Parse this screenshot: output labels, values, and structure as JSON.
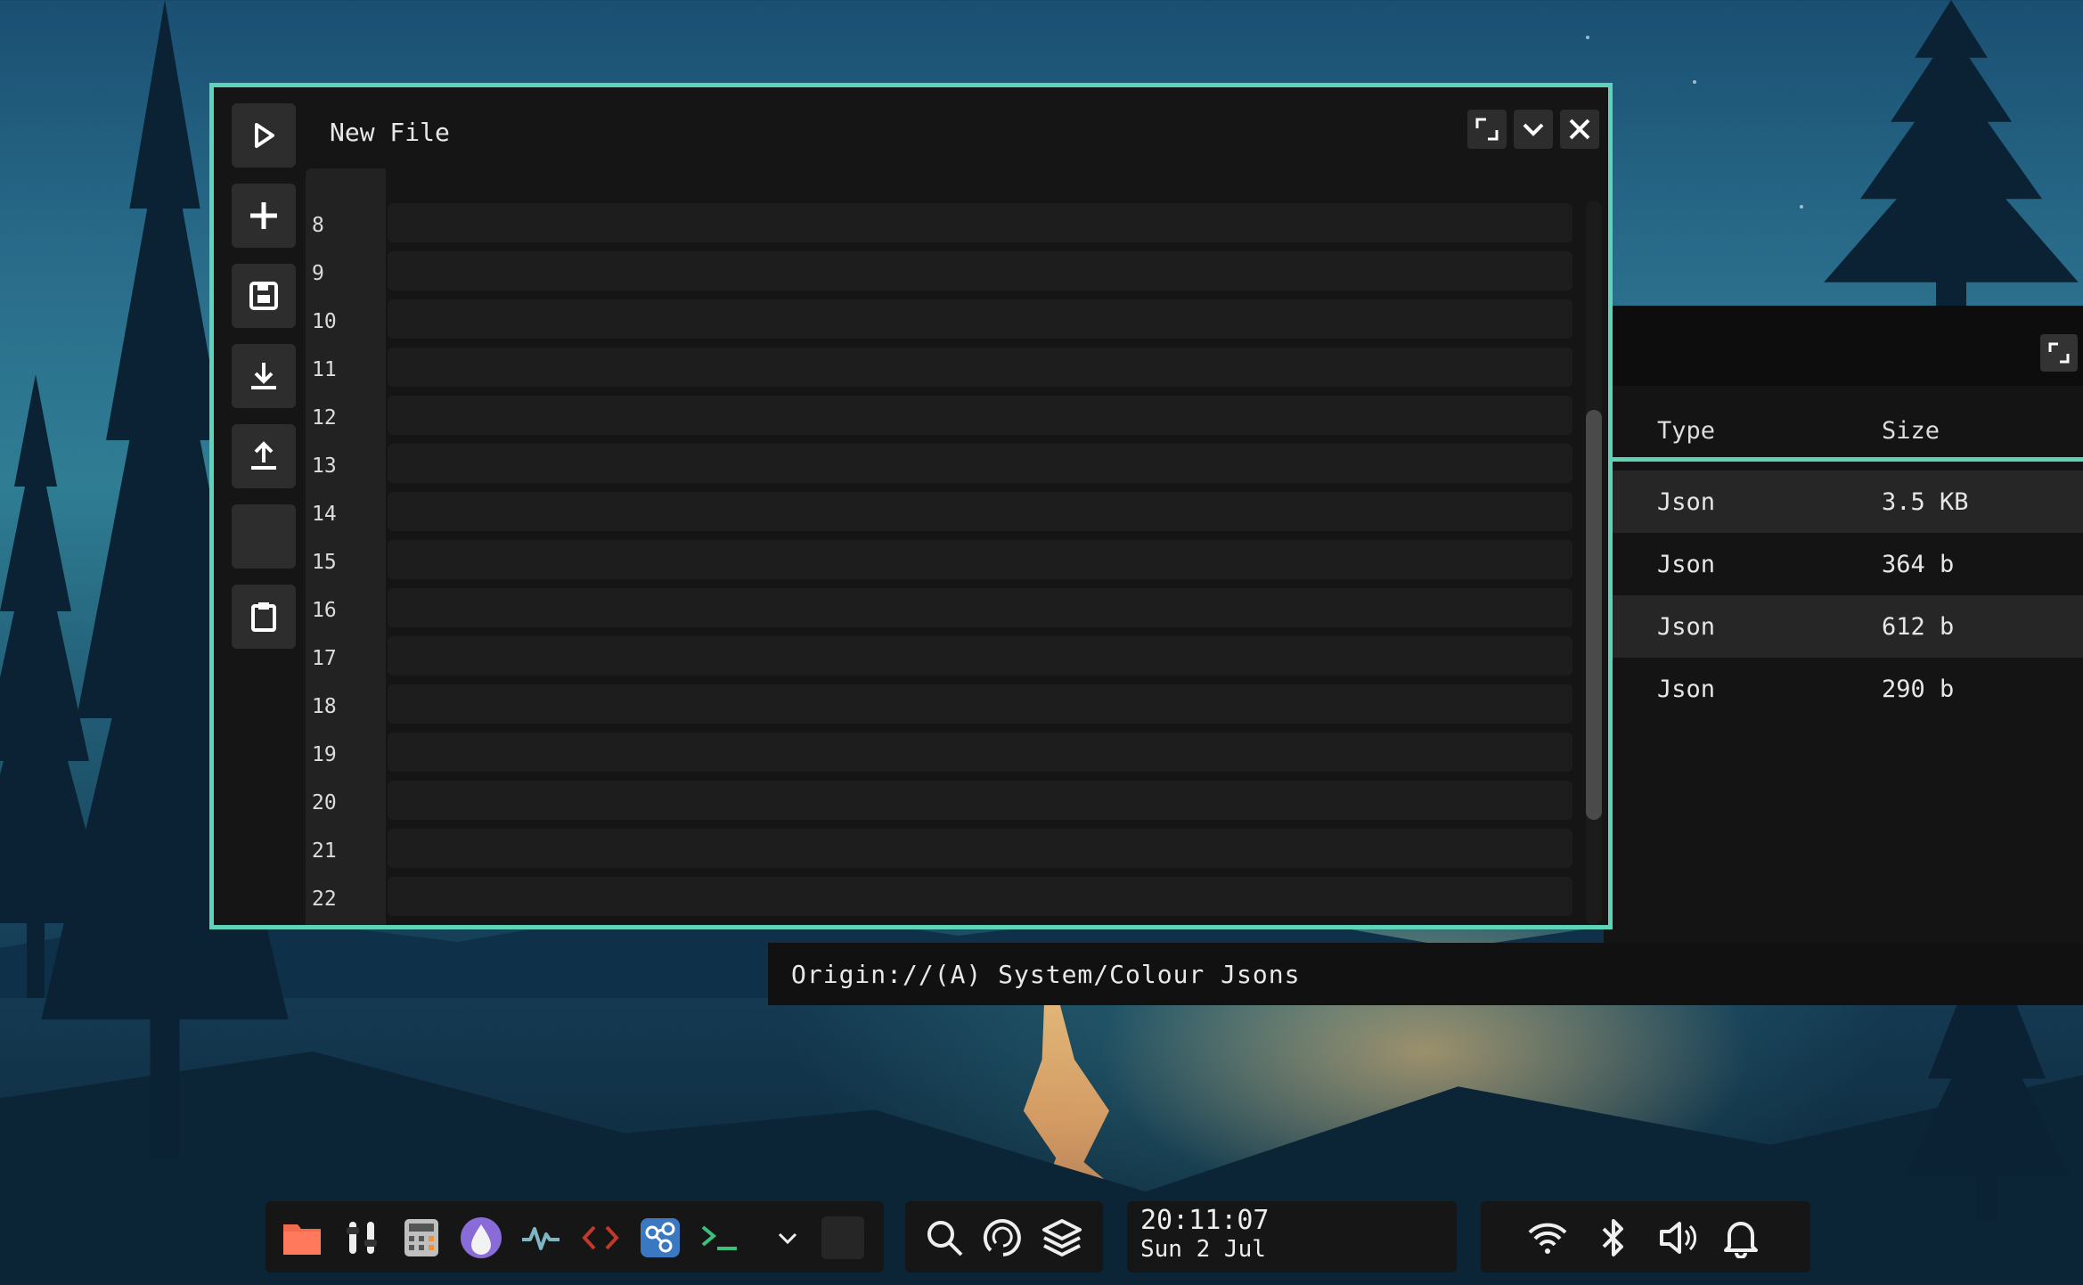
{
  "editor": {
    "title": "New File",
    "line_numbers": [
      "8",
      "9",
      "10",
      "11",
      "12",
      "13",
      "14",
      "15",
      "16",
      "17",
      "18",
      "19",
      "20",
      "21",
      "22"
    ],
    "sidebar_icons": [
      "play-icon",
      "plus-icon",
      "save-icon",
      "download-icon",
      "upload-icon",
      "blank",
      "clipboard-icon"
    ],
    "window_icons": [
      "maximize-icon",
      "chevron-down-icon",
      "close-icon"
    ]
  },
  "file_manager": {
    "columns": {
      "type": "Type",
      "size": "Size"
    },
    "rows": [
      {
        "type": "Json",
        "size": "3.5 KB"
      },
      {
        "type": "Json",
        "size": "364 b"
      },
      {
        "type": "Json",
        "size": "612 b"
      },
      {
        "type": "Json",
        "size": "290 b"
      }
    ],
    "path": "Origin://(A) System/Colour Jsons"
  },
  "taskbar": {
    "apps": [
      "folder-icon",
      "mixer-icon",
      "calculator-icon",
      "app-drop-icon",
      "activity-icon",
      "code-icon",
      "nodes-icon",
      "terminal-icon",
      "chevron-down-icon",
      "blank-slot"
    ],
    "tools": [
      "search-icon",
      "refresh-icon",
      "layers-icon"
    ],
    "clock": {
      "time": "20:11:07",
      "date": "Sun 2 Jul"
    },
    "tray": [
      "wifi-icon",
      "bluetooth-icon",
      "volume-icon",
      "bell-icon"
    ]
  },
  "colors": {
    "accent": "#5fd3b8",
    "window_bg": "#151515",
    "panel_bg": "#161616"
  }
}
